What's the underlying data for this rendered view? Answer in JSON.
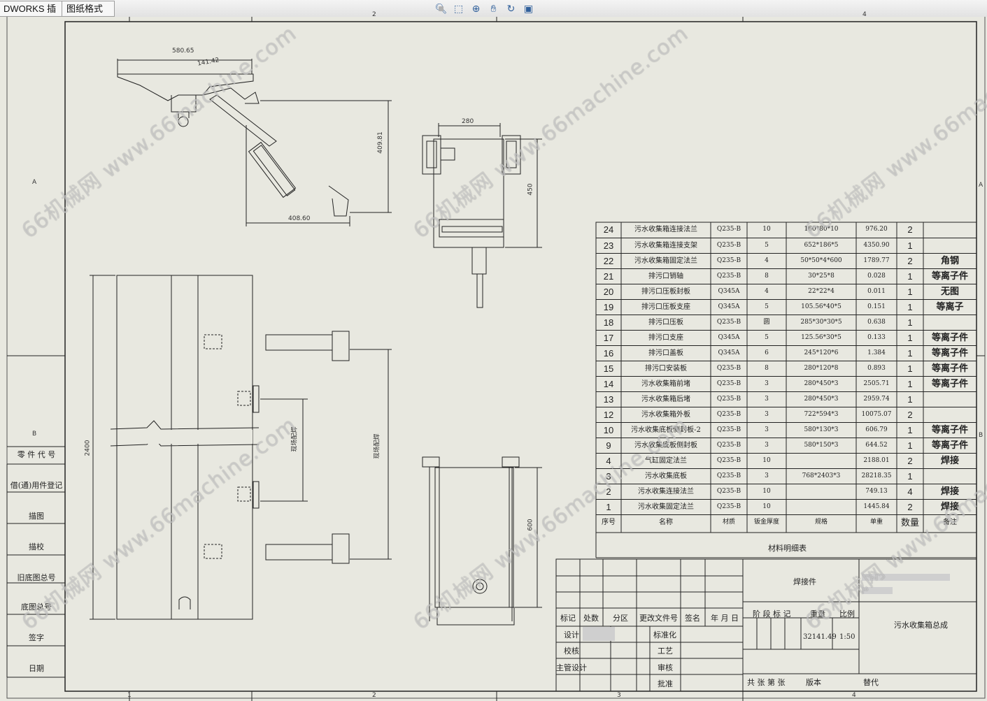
{
  "tabs": [
    {
      "label": "DWORKS 插件"
    },
    {
      "label": "图纸格式"
    }
  ],
  "toolbar_icons": [
    "zoom-to-fit-icon",
    "zoom-area-icon",
    "zoom-icon",
    "pan-icon",
    "rotate-icon",
    "view-orientation-icon",
    "display-style-icon",
    "hide-show-icon",
    "appearance-icon"
  ],
  "watermark": "66机械网 www.66machine.com",
  "border_zones": {
    "top": [
      "2",
      "4"
    ],
    "bottom": [
      "1",
      "2",
      "3",
      "4"
    ],
    "left": [
      "A",
      "B"
    ],
    "right": [
      "A",
      "B"
    ]
  },
  "side_stamp": [
    "零 件 代 号",
    "借(通)用件登记",
    "描图",
    "描校",
    "旧底图总号",
    "底图总号",
    "签字",
    "日期"
  ],
  "dimensions": {
    "v1_width": "580.65",
    "v1_angle": "141.42",
    "v1_height": "409.81",
    "v1_base": "408.60",
    "v2_width": "280",
    "v2_height": "450",
    "v3_length": "2400",
    "v3_span1": "现场配焊",
    "v3_span2": "现场配焊",
    "v4_height": "600"
  },
  "bom": {
    "rows": [
      {
        "no": "24",
        "name": "污水收集箱连接法兰",
        "material": "Q235-B",
        "thickness": "10",
        "spec": "160*80*10",
        "weight": "976.20",
        "qty": "2",
        "note": ""
      },
      {
        "no": "23",
        "name": "污水收集箱连接支架",
        "material": "Q235-B",
        "thickness": "5",
        "spec": "652*186*5",
        "weight": "4350.90",
        "qty": "1",
        "note": ""
      },
      {
        "no": "22",
        "name": "污水收集箱固定法兰",
        "material": "Q235-B",
        "thickness": "4",
        "spec": "50*50*4*600",
        "weight": "1789.77",
        "qty": "2",
        "note": "角钢"
      },
      {
        "no": "21",
        "name": "排污口销轴",
        "material": "Q235-B",
        "thickness": "8",
        "spec": "30*25*8",
        "weight": "0.028",
        "qty": "1",
        "note": "等离子件"
      },
      {
        "no": "20",
        "name": "排污口压板封板",
        "material": "Q345A",
        "thickness": "4",
        "spec": "22*22*4",
        "weight": "0.011",
        "qty": "1",
        "note": "无图"
      },
      {
        "no": "19",
        "name": "排污口压板支座",
        "material": "Q345A",
        "thickness": "5",
        "spec": "105.56*40*5",
        "weight": "0.151",
        "qty": "1",
        "note": "等离子"
      },
      {
        "no": "18",
        "name": "排污口压板",
        "material": "Q235-B",
        "thickness": "圆",
        "spec": "285*30*30*5",
        "weight": "0.638",
        "qty": "1",
        "note": ""
      },
      {
        "no": "17",
        "name": "排污口支座",
        "material": "Q345A",
        "thickness": "5",
        "spec": "125.56*30*5",
        "weight": "0.133",
        "qty": "1",
        "note": "等离子件"
      },
      {
        "no": "16",
        "name": "排污口盖板",
        "material": "Q345A",
        "thickness": "6",
        "spec": "245*120*6",
        "weight": "1.384",
        "qty": "1",
        "note": "等离子件"
      },
      {
        "no": "15",
        "name": "排污口安装板",
        "material": "Q235-B",
        "thickness": "8",
        "spec": "280*120*8",
        "weight": "0.893",
        "qty": "1",
        "note": "等离子件"
      },
      {
        "no": "14",
        "name": "污水收集箱前堵",
        "material": "Q235-B",
        "thickness": "3",
        "spec": "280*450*3",
        "weight": "2505.71",
        "qty": "1",
        "note": "等离子件"
      },
      {
        "no": "13",
        "name": "污水收集箱后堵",
        "material": "Q235-B",
        "thickness": "3",
        "spec": "280*450*3",
        "weight": "2959.74",
        "qty": "1",
        "note": ""
      },
      {
        "no": "12",
        "name": "污水收集箱外板",
        "material": "Q235-B",
        "thickness": "3",
        "spec": "722*594*3",
        "weight": "10075.07",
        "qty": "2",
        "note": ""
      },
      {
        "no": "10",
        "name": "污水收集底板侧封板-2",
        "material": "Q235-B",
        "thickness": "3",
        "spec": "580*130*3",
        "weight": "606.79",
        "qty": "1",
        "note": "等离子件"
      },
      {
        "no": "9",
        "name": "污水收集底板侧封板",
        "material": "Q235-B",
        "thickness": "3",
        "spec": "580*150*3",
        "weight": "644.52",
        "qty": "1",
        "note": "等离子件"
      },
      {
        "no": "4",
        "name": "气缸固定法兰",
        "material": "Q235-B",
        "thickness": "10",
        "spec": "",
        "weight": "2188.01",
        "qty": "2",
        "note": "焊接"
      },
      {
        "no": "3",
        "name": "污水收集底板",
        "material": "Q235-B",
        "thickness": "3",
        "spec": "768*2403*3",
        "weight": "28218.35",
        "qty": "1",
        "note": ""
      },
      {
        "no": "2",
        "name": "污水收集连接法兰",
        "material": "Q235-B",
        "thickness": "10",
        "spec": "",
        "weight": "749.13",
        "qty": "4",
        "note": "焊接"
      },
      {
        "no": "1",
        "name": "污水收集固定法兰",
        "material": "Q235-B",
        "thickness": "10",
        "spec": "",
        "weight": "1445.84",
        "qty": "2",
        "note": "焊接"
      }
    ],
    "header": {
      "no": "序号",
      "name": "名称",
      "material": "材质",
      "thickness": "钣金厚度",
      "spec": "规格",
      "weight": "单重",
      "qty": "数量",
      "note": "备注"
    },
    "caption": "材料明细表"
  },
  "title_block": {
    "weldment": "焊接件",
    "drawing_name": "污水收集箱总成",
    "mark": "标记",
    "count": "处数",
    "zone": "分区",
    "change_doc": "更改文件号",
    "sign": "签名",
    "date": "年 月 日",
    "design": "设计",
    "standardize": "标准化",
    "check": "校核",
    "process": "工艺",
    "chief": "主管设计",
    "review": "审核",
    "approve": "批准",
    "stage_mark": "阶 段 标 记",
    "weight_label": "重量",
    "scale_label": "比例",
    "weight": "32141.49",
    "scale": "1:50",
    "sheets": "共  张  第  张",
    "version": "版本",
    "replace": "替代"
  }
}
